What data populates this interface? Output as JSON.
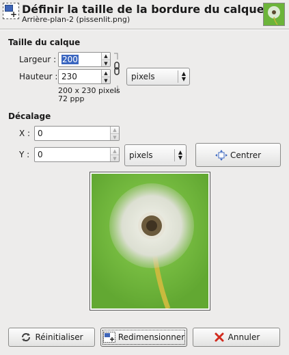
{
  "header": {
    "title": "Définir la taille de la bordure du calque",
    "subtitle": "Arrière-plan-2 (pissenlit.png)"
  },
  "layer_size": {
    "section_label": "Taille du calque",
    "width_label": "Largeur :",
    "width_value": "200",
    "height_label": "Hauteur :",
    "height_value": "230",
    "unit": "pixels",
    "info_size": "200 x 230 pixels",
    "info_resolution": "72 ppp"
  },
  "offset": {
    "section_label": "Décalage",
    "x_label": "X :",
    "x_value": "0",
    "y_label": "Y :",
    "y_value": "0",
    "unit": "pixels",
    "center_button": "Centrer"
  },
  "buttons": {
    "reset": "Réinitialiser",
    "resize": "Redimensionner",
    "cancel": "Annuler"
  },
  "colors": {
    "accent": "#3a66c0",
    "preview_bg": "#72b93e",
    "cancel_icon": "#d22b1e"
  },
  "icons": {
    "header": "layer-boundary-icon",
    "chain": "chain-link-icon",
    "center": "center-icon",
    "reset": "reset-icon",
    "resize": "resize-icon",
    "cancel": "cancel-icon"
  }
}
